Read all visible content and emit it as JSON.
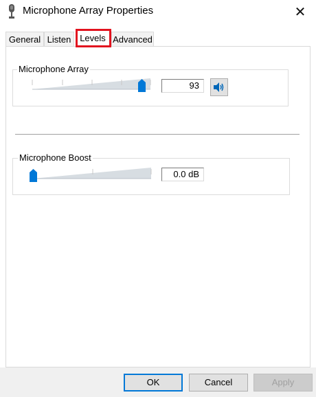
{
  "window": {
    "title": "Microphone Array Properties",
    "icon": "microphone-icon",
    "close_glyph": "✕"
  },
  "tabs": [
    {
      "label": "General",
      "selected": false
    },
    {
      "label": "Listen",
      "selected": false
    },
    {
      "label": "Levels",
      "selected": true
    },
    {
      "label": "Advanced",
      "selected": false
    }
  ],
  "levels": {
    "microphone_array": {
      "label": "Microphone Array",
      "value": "93",
      "level_fraction": 0.93,
      "mute_icon": "speaker-icon"
    },
    "microphone_boost": {
      "label": "Microphone Boost",
      "value": "0.0 dB",
      "level_fraction": 0.0
    }
  },
  "buttons": {
    "ok": "OK",
    "cancel": "Cancel",
    "apply": "Apply"
  },
  "colors": {
    "highlight": "#e2131f",
    "slider_thumb": "#0078d7",
    "default_button_border": "#0078d7"
  }
}
